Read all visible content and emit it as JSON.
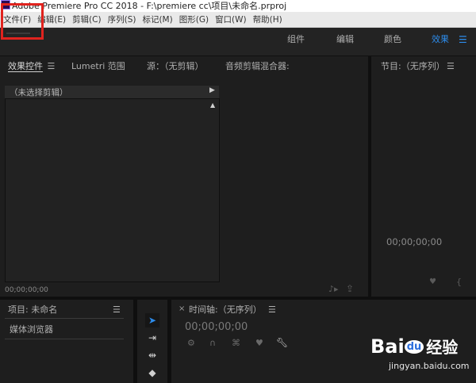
{
  "window": {
    "title": "Adobe Premiere Pro CC 2018 - F:\\premiere cc\\项目\\未命名.prproj"
  },
  "menu": [
    "文件(F)",
    "编辑(E)",
    "剪辑(C)",
    "序列(S)",
    "标记(M)",
    "图形(G)",
    "窗口(W)",
    "帮助(H)"
  ],
  "workspace_tabs": [
    {
      "label": "组件"
    },
    {
      "label": "编辑"
    },
    {
      "label": "颜色"
    },
    {
      "label": "效果",
      "active": true
    }
  ],
  "source_panel": {
    "tabs": [
      "效果控件",
      "Lumetri 范围",
      "源：（无剪辑）",
      "音频剪辑混合器:"
    ],
    "clip_label": "（未选择剪辑）",
    "timecode": "00;00;00;00"
  },
  "program_panel": {
    "title": "节目:（无序列）",
    "timecode": "00;00;00;00"
  },
  "project_panel": {
    "title": "项目: 未命名",
    "media_browser": "媒体浏览器"
  },
  "timeline_panel": {
    "title": "时间轴:（无序列）",
    "timecode": "00;00;00;00"
  },
  "watermark": {
    "brand": "Bai",
    "paw": "du",
    "suffix": "经验",
    "url": "jingyan.baidu.com"
  },
  "colors": {
    "accent": "#2d8ceb",
    "highlight": "#e0231e",
    "panel_bg": "#1e1e1e"
  }
}
